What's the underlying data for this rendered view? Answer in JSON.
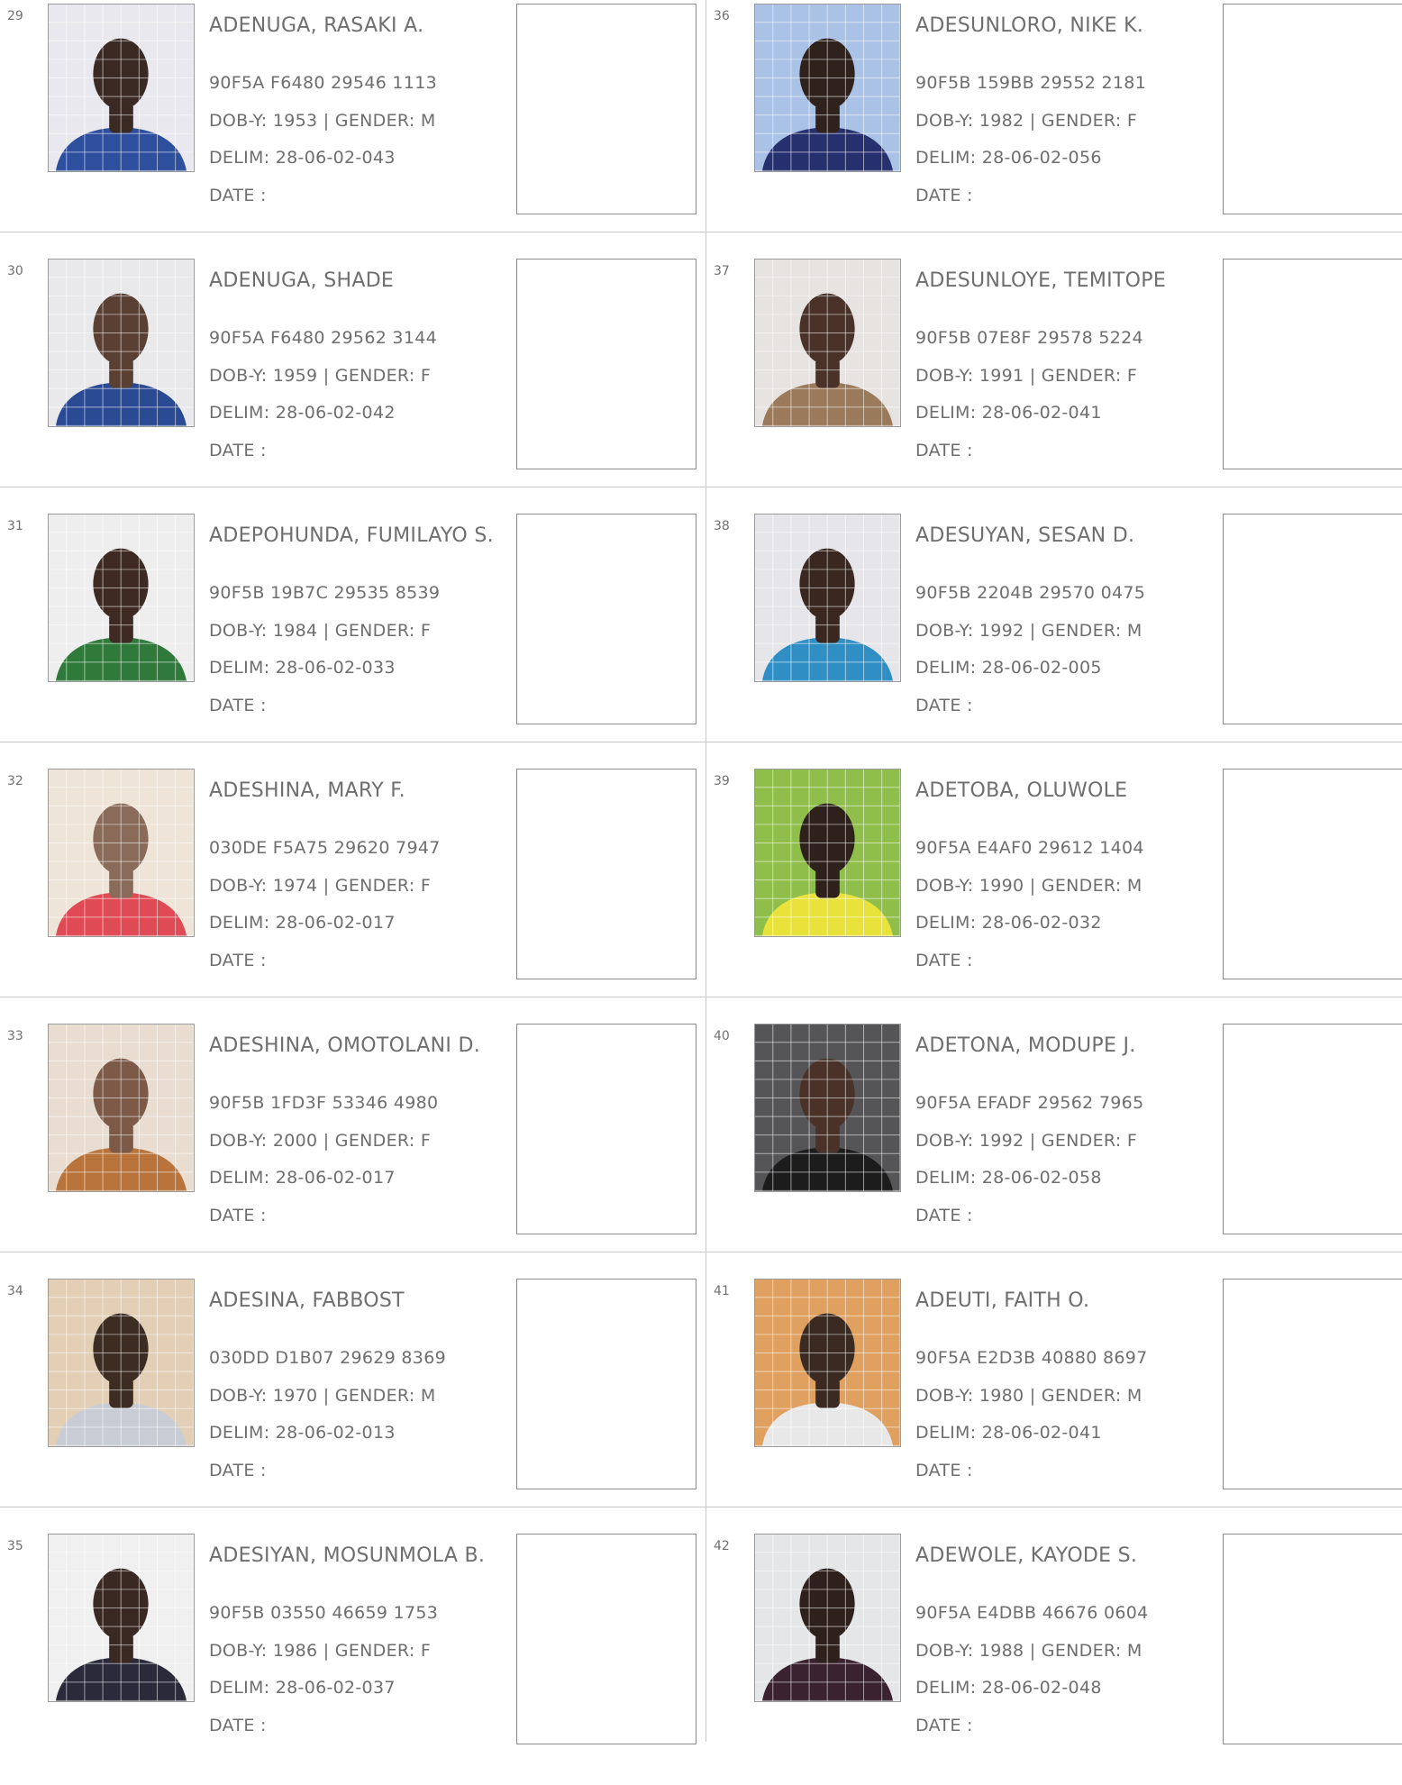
{
  "columns": [
    [
      {
        "serial": "29",
        "name": "ADENUGA, RASAKI A.",
        "vin": "90F5A F6480 29546 1113",
        "dob": "DOB-Y: 1953",
        "gender": "GENDER: M",
        "delim": "DELIM: 28-06-02-043",
        "date": "DATE  :",
        "photo": {
          "bg": "#e8e8ee",
          "shirt": "#2e4f9e",
          "skin": "#3b2a24"
        }
      },
      {
        "serial": "30",
        "name": "ADENUGA, SHADE",
        "vin": "90F5A F6480 29562 3144",
        "dob": "DOB-Y: 1959",
        "gender": "GENDER: F",
        "delim": "DELIM: 28-06-02-042",
        "date": "DATE  :",
        "photo": {
          "bg": "#e9e9ec",
          "shirt": "#2b4a94",
          "skin": "#5a3f33"
        }
      },
      {
        "serial": "31",
        "name": "ADEPOHUNDA, FUMILAYO S.",
        "vin": "90F5B 19B7C 29535 8539",
        "dob": "DOB-Y: 1984",
        "gender": "GENDER: F",
        "delim": "DELIM: 28-06-02-033",
        "date": "DATE  :",
        "photo": {
          "bg": "#eeeeee",
          "shirt": "#2f7a3a",
          "skin": "#3e2a22"
        }
      },
      {
        "serial": "32",
        "name": "ADESHINA, MARY F.",
        "vin": "030DE F5A75 29620 7947",
        "dob": "DOB-Y: 1974",
        "gender": "GENDER: F",
        "delim": "DELIM: 28-06-02-017",
        "date": "DATE  :",
        "photo": {
          "bg": "#efe4d8",
          "shirt": "#e04a55",
          "skin": "#8a6a58"
        }
      },
      {
        "serial": "33",
        "name": "ADESHINA, OMOTOLANI D.",
        "vin": "90F5B 1FD3F 53346 4980",
        "dob": "DOB-Y: 2000",
        "gender": "GENDER: F",
        "delim": "DELIM: 28-06-02-017",
        "date": "DATE  :",
        "photo": {
          "bg": "#e9ddd2",
          "shirt": "#b8743a",
          "skin": "#7c5a47"
        }
      },
      {
        "serial": "34",
        "name": "ADESINA, FABBOST",
        "vin": "030DD D1B07 29629 8369",
        "dob": "DOB-Y: 1970",
        "gender": "GENDER: M",
        "delim": "DELIM: 28-06-02-013",
        "date": "DATE  :",
        "photo": {
          "bg": "#e2cfb6",
          "shirt": "#c8ccd4",
          "skin": "#3d2c22"
        }
      },
      {
        "serial": "35",
        "name": "ADESIYAN, MOSUNMOLA B.",
        "vin": "90F5B 03550 46659 1753",
        "dob": "DOB-Y: 1986",
        "gender": "GENDER: F",
        "delim": "DELIM: 28-06-02-037",
        "date": "DATE  :",
        "photo": {
          "bg": "#f0f0f0",
          "shirt": "#2a2a3a",
          "skin": "#3a2822"
        }
      }
    ],
    [
      {
        "serial": "36",
        "name": "ADESUNLORO, NIKE K.",
        "vin": "90F5B 159BB 29552 2181",
        "dob": "DOB-Y: 1982",
        "gender": "GENDER: F",
        "delim": "DELIM: 28-06-02-056",
        "date": "DATE  :",
        "photo": {
          "bg": "#a9c2e6",
          "shirt": "#27306e",
          "skin": "#2f221d"
        }
      },
      {
        "serial": "37",
        "name": "ADESUNLOYE, TEMITOPE",
        "vin": "90F5B 07E8F 29578 5224",
        "dob": "DOB-Y: 1991",
        "gender": "GENDER: F",
        "delim": "DELIM: 28-06-02-041",
        "date": "DATE  :",
        "photo": {
          "bg": "#e6e3e0",
          "shirt": "#9a7a5a",
          "skin": "#4a3228"
        }
      },
      {
        "serial": "38",
        "name": "ADESUYAN, SESAN D.",
        "vin": "90F5B 2204B 29570 0475",
        "dob": "DOB-Y: 1992",
        "gender": "GENDER: M",
        "delim": "DELIM: 28-06-02-005",
        "date": "DATE  :",
        "photo": {
          "bg": "#e6e6ea",
          "shirt": "#2f8fc4",
          "skin": "#3a2720"
        }
      },
      {
        "serial": "39",
        "name": "ADETOBA, OLUWOLE",
        "vin": "90F5A E4AF0 29612 1404",
        "dob": "DOB-Y: 1990",
        "gender": "GENDER: M",
        "delim": "DELIM: 28-06-02-032",
        "date": "DATE  :",
        "photo": {
          "bg": "#8fbf4a",
          "shirt": "#e8e23a",
          "skin": "#2e211c"
        }
      },
      {
        "serial": "40",
        "name": "ADETONA, MODUPE J.",
        "vin": "90F5A EFADF 29562 7965",
        "dob": "DOB-Y: 1992",
        "gender": "GENDER: F",
        "delim": "DELIM: 28-06-02-058",
        "date": "DATE  :",
        "photo": {
          "bg": "#555558",
          "shirt": "#1c1c1c",
          "skin": "#4a3228"
        }
      },
      {
        "serial": "41",
        "name": "ADEUTI, FAITH O.",
        "vin": "90F5A E2D3B 40880 8697",
        "dob": "DOB-Y: 1980",
        "gender": "GENDER: M",
        "delim": "DELIM: 28-06-02-041",
        "date": "DATE  :",
        "photo": {
          "bg": "#e0a060",
          "shirt": "#e8e8e8",
          "skin": "#3a2a22"
        }
      },
      {
        "serial": "42",
        "name": "ADEWOLE, KAYODE S.",
        "vin": "90F5A E4DBB 46676 0604",
        "dob": "DOB-Y: 1988",
        "gender": "GENDER: M",
        "delim": "DELIM: 28-06-02-048",
        "date": "DATE  :",
        "photo": {
          "bg": "#e4e6e8",
          "shirt": "#3a2230",
          "skin": "#2e211c"
        }
      }
    ]
  ]
}
